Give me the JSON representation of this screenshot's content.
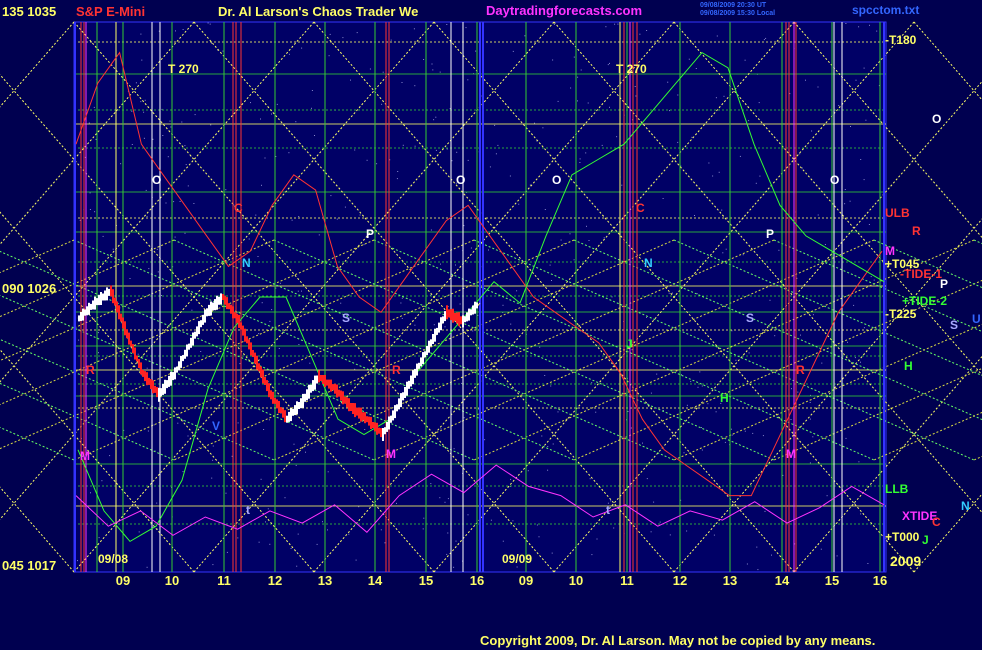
{
  "header": {
    "symbol_scale": "135  1035",
    "instrument": "S&P E-Mini",
    "title": "Dr. Al Larson's Chaos Trader We",
    "site": "Daytradingforecasts.com",
    "timestamp_line1": "09/08/2009 20:30 UT",
    "timestamp_line2": "09/08/2009 15:30 Local",
    "file": "spcctom.txt"
  },
  "axis": {
    "top_left": "135  1035",
    "mid_left": "090  1026",
    "bottom_left": "045  1017",
    "year": "2009",
    "date_left": "09/08",
    "date_right": "09/09"
  },
  "footer": {
    "copyright": "Copyright 2009, Dr. Al Larson. May not be copied by any means."
  },
  "chart_data": {
    "type": "line",
    "title": "Dr. Al Larson's Chaos Trader We",
    "y_price_range": [
      1017,
      1035
    ],
    "y_angle_range": [
      45,
      135
    ],
    "x_hours_session1": [
      "09",
      "10",
      "11",
      "12",
      "13",
      "14",
      "15",
      "16"
    ],
    "x_hours_session2": [
      "09",
      "10",
      "11",
      "12",
      "13",
      "14",
      "15",
      "16"
    ],
    "sessions": [
      "09/08",
      "09/09"
    ],
    "right_labels": [
      {
        "text": "-T180",
        "color": "#ffff66"
      },
      {
        "text": "ULB",
        "color": "#ff3333"
      },
      {
        "text": "R",
        "color": "#ff3333"
      },
      {
        "text": "M",
        "color": "#ff33ff"
      },
      {
        "text": "+T045",
        "color": "#ffff66"
      },
      {
        "text": "-TIDE-1",
        "color": "#ff3333"
      },
      {
        "text": "P",
        "color": "#ffffff"
      },
      {
        "text": "+TIDE-2",
        "color": "#33ff33"
      },
      {
        "text": "-T225",
        "color": "#ffff66"
      },
      {
        "text": "S",
        "color": "#aaaaff"
      },
      {
        "text": "U",
        "color": "#3366ff"
      },
      {
        "text": "H",
        "color": "#33ff33"
      },
      {
        "text": "LLB",
        "color": "#33ff33"
      },
      {
        "text": "N",
        "color": "#33ccff"
      },
      {
        "text": "XTIDE",
        "color": "#ff33ff"
      },
      {
        "text": "C",
        "color": "#ff3333"
      },
      {
        "text": "+T000",
        "color": "#ffff66"
      },
      {
        "text": "J",
        "color": "#33ff33"
      },
      {
        "text": "O",
        "color": "#ffffff"
      }
    ],
    "in_chart_labels": [
      {
        "text": "T  270",
        "color": "#ffff66"
      },
      {
        "text": "T  270",
        "color": "#ffff66"
      },
      {
        "text": "O",
        "color": "#ffffff"
      },
      {
        "text": "O",
        "color": "#ffffff"
      },
      {
        "text": "O",
        "color": "#ffffff"
      },
      {
        "text": "O",
        "color": "#ffffff"
      },
      {
        "text": "C",
        "color": "#ff3333"
      },
      {
        "text": "C",
        "color": "#ff3333"
      },
      {
        "text": "N",
        "color": "#33ccff"
      },
      {
        "text": "N",
        "color": "#33ccff"
      },
      {
        "text": "P",
        "color": "#ffffff"
      },
      {
        "text": "P",
        "color": "#ffffff"
      },
      {
        "text": "S",
        "color": "#aaaaff"
      },
      {
        "text": "S",
        "color": "#aaaaff"
      },
      {
        "text": "R",
        "color": "#ff3333"
      },
      {
        "text": "R",
        "color": "#ff3333"
      },
      {
        "text": "R",
        "color": "#ff3333"
      },
      {
        "text": "M",
        "color": "#ff33ff"
      },
      {
        "text": "M",
        "color": "#ff33ff"
      },
      {
        "text": "M",
        "color": "#ff33ff"
      },
      {
        "text": "V",
        "color": "#3366ff"
      },
      {
        "text": "J",
        "color": "#33ff33"
      },
      {
        "text": "H",
        "color": "#33ff33"
      },
      {
        "text": "t",
        "color": "#aaaaff"
      },
      {
        "text": "t",
        "color": "#aaaaff"
      }
    ],
    "series": [
      {
        "color": "#ffffff",
        "values": [
          1025.3,
          1025.8,
          1026.2,
          1024.8,
          1023.5,
          1022.8,
          1023.5,
          1024.5,
          1025.5,
          1026.0,
          1025.2,
          1024.0,
          1022.8,
          1022.0,
          1022.6,
          1023.4,
          1023.0,
          1022.4,
          1022.0,
          1021.5,
          1022.5,
          1023.5,
          1024.5,
          1025.5,
          1025.2,
          1025.8
        ]
      },
      {
        "color": "#ff3333",
        "values": [
          1031,
          1033,
          1034,
          1031,
          1030,
          1029,
          1028,
          1027,
          1027.5,
          1029,
          1030,
          1029.5,
          1027,
          1026,
          1025.5,
          1026.5,
          1027.5,
          1028.5,
          1029,
          1028,
          1027,
          1026,
          1025.5,
          1025,
          1024.5,
          1023.5,
          1022,
          1021,
          1020.5,
          1020,
          1019.5,
          1019.5,
          1021,
          1022.5,
          1024,
          1025.5,
          1026.5,
          1027.5
        ]
      },
      {
        "color": "#33ff33",
        "values": [
          1021,
          1019,
          1018,
          1018.5,
          1020,
          1023,
          1025,
          1026,
          1026,
          1024,
          1022,
          1021.5,
          1022,
          1023.5,
          1024.5,
          1025.5,
          1026.5,
          1025.8,
          1028,
          1030,
          1030.5,
          1031,
          1032,
          1033,
          1034,
          1033.5,
          1031,
          1029,
          1028,
          1027.5,
          1027,
          1026.5
        ]
      },
      {
        "color": "#ff33ff",
        "values": [
          1019.5,
          1018.5,
          1019,
          1018.2,
          1018.8,
          1018.4,
          1019,
          1018.6,
          1019.2,
          1018.3,
          1019.5,
          1020.2,
          1019.6,
          1020.5,
          1019.8,
          1019.5,
          1018.8,
          1019.2,
          1018.5,
          1019.0,
          1018.7,
          1019.3,
          1018.6,
          1019.1,
          1019.8,
          1019.2
        ]
      }
    ]
  }
}
